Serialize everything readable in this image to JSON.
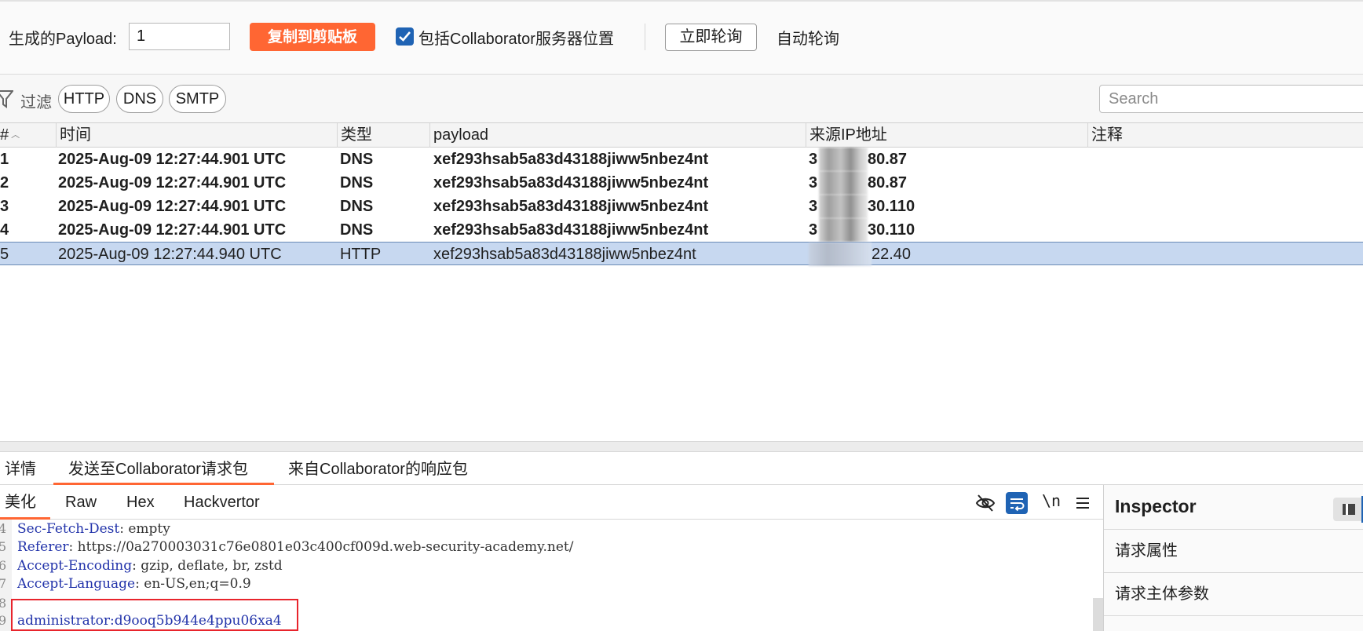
{
  "toolbar": {
    "payload_label": "生成的Payload:",
    "payload_value": "1",
    "copy_button": "复制到剪贴板",
    "include_checkbox_label": "包括Collaborator服务器位置",
    "include_checked": true,
    "poll_now_button": "立即轮询",
    "auto_poll_label": "自动轮询",
    "accent_color": "#ff6633"
  },
  "filter": {
    "label": "过滤",
    "chips": [
      "HTTP",
      "DNS",
      "SMTP"
    ],
    "search_placeholder": "Search"
  },
  "table": {
    "columns": [
      "#",
      "时间",
      "类型",
      "payload",
      "来源IP地址",
      "注释"
    ],
    "rows": [
      {
        "num": "1",
        "time": "2025-Aug-09 12:27:44.901 UTC",
        "type": "DNS",
        "payload": "xef293hsab5a83d43188jiww5nbez4nt",
        "ip_prefix": "3",
        "ip_suffix": "80.87",
        "comment": "",
        "unread": true,
        "selected": false
      },
      {
        "num": "2",
        "time": "2025-Aug-09 12:27:44.901 UTC",
        "type": "DNS",
        "payload": "xef293hsab5a83d43188jiww5nbez4nt",
        "ip_prefix": "3",
        "ip_suffix": "80.87",
        "comment": "",
        "unread": true,
        "selected": false
      },
      {
        "num": "3",
        "time": "2025-Aug-09 12:27:44.901 UTC",
        "type": "DNS",
        "payload": "xef293hsab5a83d43188jiww5nbez4nt",
        "ip_prefix": "3",
        "ip_suffix": "30.110",
        "comment": "",
        "unread": true,
        "selected": false
      },
      {
        "num": "4",
        "time": "2025-Aug-09 12:27:44.901 UTC",
        "type": "DNS",
        "payload": "xef293hsab5a83d43188jiww5nbez4nt",
        "ip_prefix": "3",
        "ip_suffix": "30.110",
        "comment": "",
        "unread": true,
        "selected": false
      },
      {
        "num": "5",
        "time": "2025-Aug-09 12:27:44.940 UTC",
        "type": "HTTP",
        "payload": "xef293hsab5a83d43188jiww5nbez4nt",
        "ip_prefix": "",
        "ip_suffix": "22.40",
        "comment": "",
        "unread": false,
        "selected": true
      }
    ]
  },
  "detail_tabs": [
    "详情",
    "发送至Collaborator请求包",
    "来自Collaborator的响应包"
  ],
  "detail_active": 1,
  "view_tabs": [
    "美化",
    "Raw",
    "Hex",
    "Hackvertor"
  ],
  "view_active": 0,
  "view_tools": {
    "newline_label": "\\n"
  },
  "code_lines": [
    {
      "n": "4",
      "key": "Sec-Fetch-Dest",
      "val": ": empty"
    },
    {
      "n": "5",
      "key": "Referer",
      "val": ": https://0a270003031c76e0801e03c400cf009d.web-security-academy.net/"
    },
    {
      "n": "6",
      "key": "Accept-Encoding",
      "val": ": gzip, deflate, br, zstd"
    },
    {
      "n": "7",
      "key": "Accept-Language",
      "val": ": en-US,en;q=0.9"
    },
    {
      "n": "8",
      "key": "",
      "val": ""
    },
    {
      "n": "9",
      "key": "administrator:d9ooq5b944e4ppu06xa4",
      "val": ""
    }
  ],
  "inspector": {
    "title": "Inspector",
    "items": [
      "请求属性",
      "请求主体参数"
    ]
  }
}
